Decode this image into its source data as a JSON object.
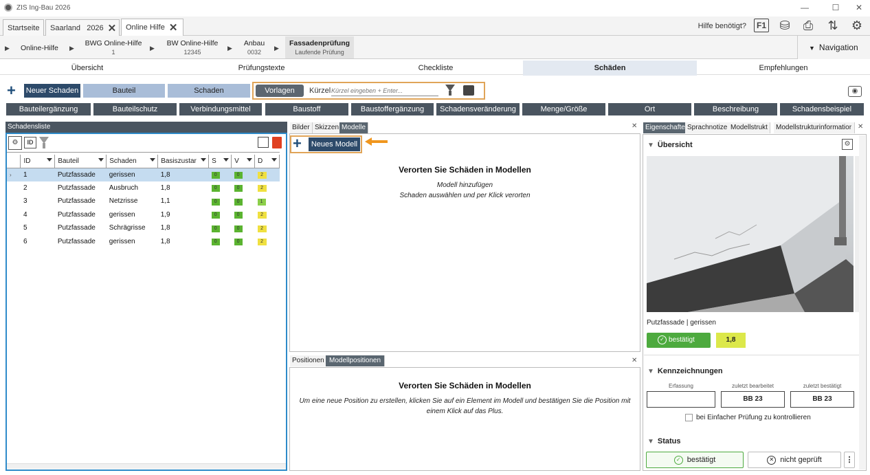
{
  "window": {
    "title": "ZIS Ing-Bau 2026"
  },
  "tabs": [
    {
      "label": "Startseite"
    },
    {
      "label": "Saarland   2026"
    },
    {
      "label": "Online Hilfe"
    }
  ],
  "header": {
    "help_text": "Hilfe benötigt?",
    "f1_label": "F1"
  },
  "breadcrumb": [
    {
      "title": "Online-Hilfe",
      "sub": ""
    },
    {
      "title": "BWG Online-Hilfe",
      "sub": "1"
    },
    {
      "title": "BW Online-Hilfe",
      "sub": "12345"
    },
    {
      "title": "Anbau",
      "sub": "0032"
    },
    {
      "title": "Fassadenprüfung",
      "sub": "Laufende Prüfung"
    }
  ],
  "navigation_label": "Navigation",
  "main_tabs": [
    "Übersicht",
    "Prüfungstexte",
    "Checkliste",
    "Schäden",
    "Empfehlungen"
  ],
  "toolbar": {
    "neuer_schaden": "Neuer Schaden",
    "bauteil": "Bauteil",
    "schaden": "Schaden",
    "vorlagen": "Vorlagen",
    "kurzel_label": "Kürzel",
    "kurzel_placeholder": "Kürzel eingeben + Enter..."
  },
  "categories": [
    "Bauteilergänzung",
    "Bauteilschutz",
    "Verbindungsmittel",
    "Baustoff",
    "Baustoffergänzung",
    "Schadensveränderung",
    "Menge/Größe",
    "Ort",
    "Beschreibung",
    "Schadensbeispiel"
  ],
  "schadensliste": {
    "title": "Schadensliste",
    "id_label": "ID",
    "columns": [
      "ID",
      "Bauteil",
      "Schaden",
      "Basiszustar",
      "S",
      "V",
      "D"
    ],
    "rows": [
      {
        "id": "1",
        "bauteil": "Putzfassade",
        "schaden": "gerissen",
        "basis": "1,8",
        "s": "0",
        "v": "0",
        "d": "2"
      },
      {
        "id": "2",
        "bauteil": "Putzfassade",
        "schaden": "Ausbruch",
        "basis": "1,8",
        "s": "0",
        "v": "0",
        "d": "2"
      },
      {
        "id": "3",
        "bauteil": "Putzfassade",
        "schaden": "Netzrisse",
        "basis": "1,1",
        "s": "0",
        "v": "0",
        "d": "1"
      },
      {
        "id": "4",
        "bauteil": "Putzfassade",
        "schaden": "gerissen",
        "basis": "1,9",
        "s": "0",
        "v": "0",
        "d": "2"
      },
      {
        "id": "5",
        "bauteil": "Putzfassade",
        "schaden": "Schrägrisse",
        "basis": "1,8",
        "s": "0",
        "v": "0",
        "d": "2"
      },
      {
        "id": "6",
        "bauteil": "Putzfassade",
        "schaden": "gerissen",
        "basis": "1,8",
        "s": "0",
        "v": "0",
        "d": "2"
      }
    ]
  },
  "middle": {
    "tabs": [
      "Bilder",
      "Skizzen",
      "Modelle"
    ],
    "neues_modell": "Neues Modell",
    "title": "Verorten Sie Schäden in Modellen",
    "line1": "Modell hinzufügen",
    "line2": "Schaden auswählen und per Klick verorten",
    "lower_tabs": [
      "Positionen",
      "Modellpositionen"
    ],
    "lower_title": "Verorten Sie Schäden in Modellen",
    "lower_text": "Um eine neue Position zu erstellen, klicken Sie auf ein Element im Modell und bestätigen Sie die Position mit einem Klick auf das Plus."
  },
  "right": {
    "tabs": [
      "Eigenschafte",
      "Sprachnotize",
      "Modellstrukt",
      "Modellstrukturinformatior"
    ],
    "uebersicht": "Übersicht",
    "caption": "Putzfassade | gerissen",
    "bestaetigt": "bestätigt",
    "value": "1,8",
    "kennzeichnungen": "Kennzeichnungen",
    "k_labels": [
      "Erfassung",
      "zuletzt bearbeitet",
      "zuletzt bestätigt"
    ],
    "k_values": [
      "",
      "BB 23",
      "BB 23"
    ],
    "checkbox_label": "bei Einfacher Prüfung zu kontrollieren",
    "status": "Status",
    "status_bestaetigt": "bestätigt",
    "status_nicht": "nicht geprüft"
  }
}
